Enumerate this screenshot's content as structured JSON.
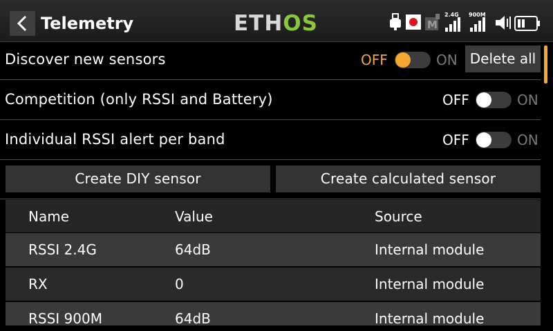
{
  "header": {
    "title": "Telemetry",
    "logo_part1": "ETH",
    "logo_part2": "OS",
    "rf_24_label": "2.4G",
    "rf_900_label": "900M",
    "module_label": "M"
  },
  "options": [
    {
      "label": "Discover new sensors",
      "off": "OFF",
      "on": "ON",
      "state": "off",
      "highlighted": true
    },
    {
      "label": "Competition (only RSSI and Battery)",
      "off": "OFF",
      "on": "ON",
      "state": "off",
      "highlighted": false
    },
    {
      "label": "Individual RSSI alert per band",
      "off": "OFF",
      "on": "ON",
      "state": "off",
      "highlighted": false
    }
  ],
  "delete_all_label": "Delete all",
  "create_diy_label": "Create DIY sensor",
  "create_calc_label": "Create calculated sensor",
  "table": {
    "headers": [
      "Name",
      "Value",
      "Source"
    ],
    "rows": [
      [
        "RSSI 2.4G",
        "64dB",
        "Internal module"
      ],
      [
        "RX",
        "0",
        "Internal module"
      ],
      [
        "RSSI 900M",
        "64dB",
        "Internal module"
      ]
    ]
  },
  "colors": {
    "accent": "#f5a82e",
    "logo_green": "#8ac63a",
    "record": "#e0141e"
  }
}
